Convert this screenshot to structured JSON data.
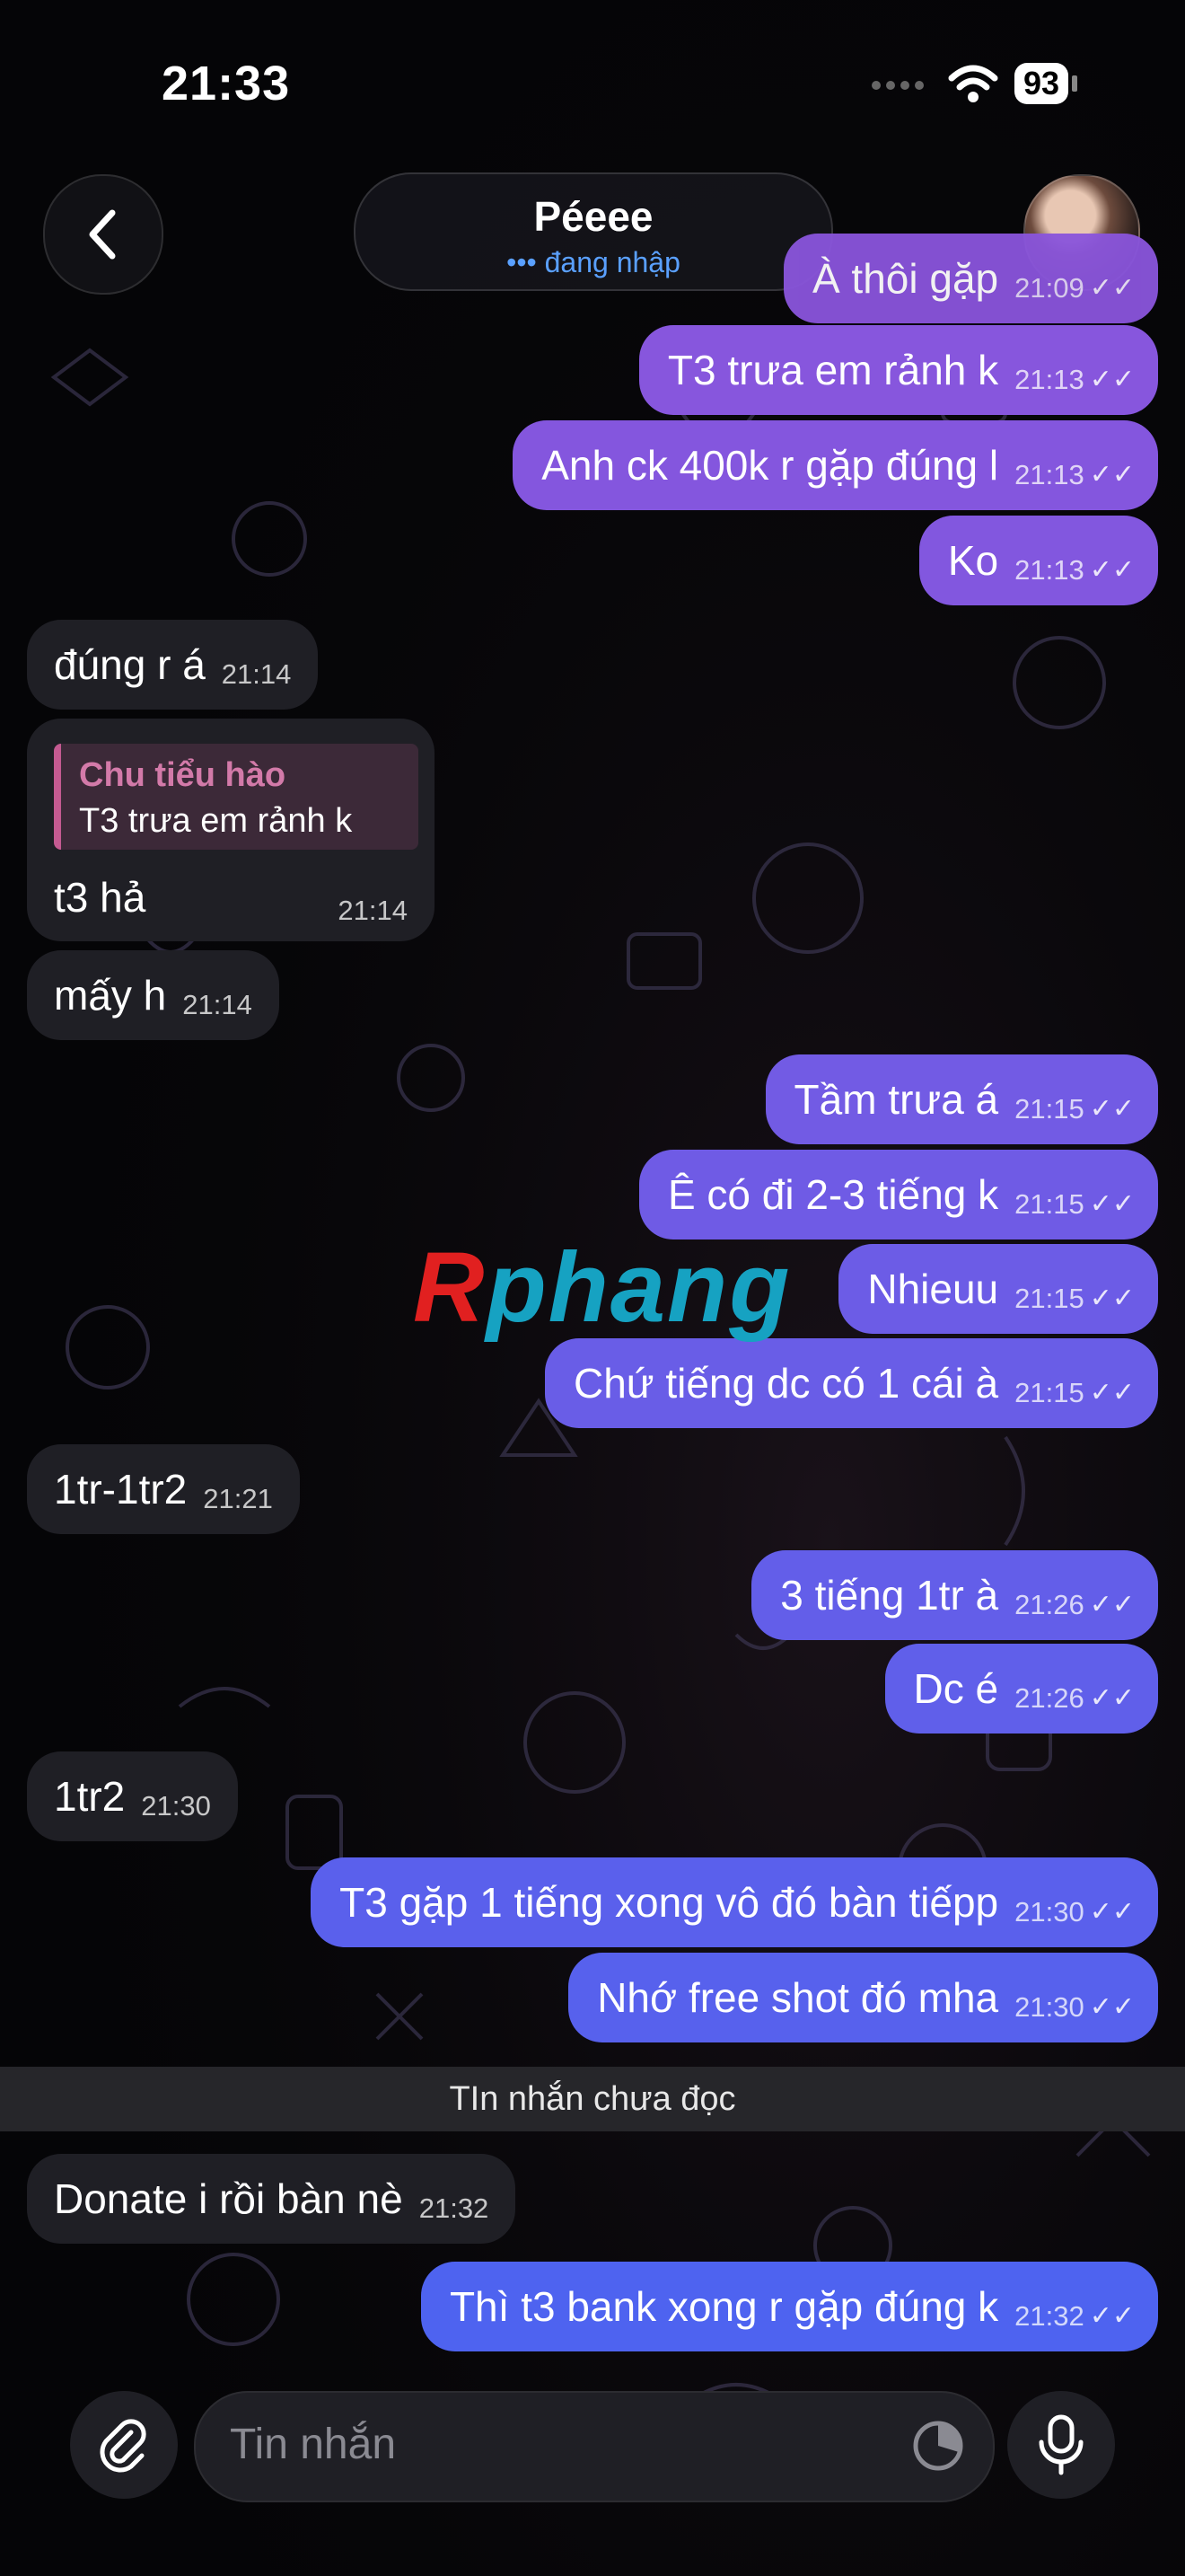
{
  "status_bar": {
    "time": "21:33",
    "battery": "93"
  },
  "header": {
    "contact_name": "Péeee",
    "contact_status": "đang nhập"
  },
  "messages": [
    {
      "dir": "out",
      "text": "À thôi gặp",
      "time": "21:09"
    },
    {
      "dir": "out",
      "text": "T3 trưa em rảnh k",
      "time": "21:13"
    },
    {
      "dir": "out",
      "text": "Anh ck 400k r gặp đúng l",
      "time": "21:13"
    },
    {
      "dir": "out",
      "text": "Ko",
      "time": "21:13"
    },
    {
      "dir": "in",
      "text": "đúng r á",
      "time": "21:14"
    },
    {
      "dir": "in",
      "text": "t3 hả",
      "time": "21:14",
      "reply_to_name": "Chu tiểu hào",
      "reply_to_text": "T3 trưa em rảnh k"
    },
    {
      "dir": "in",
      "text": "mấy h",
      "time": "21:14"
    },
    {
      "dir": "out",
      "text": "Tầm trưa á",
      "time": "21:15"
    },
    {
      "dir": "out",
      "text": "Ê có đi 2-3 tiếng k",
      "time": "21:15"
    },
    {
      "dir": "out",
      "text": "Nhieuu",
      "time": "21:15"
    },
    {
      "dir": "out",
      "text": "Chứ tiếng dc có 1 cái à",
      "time": "21:15"
    },
    {
      "dir": "in",
      "text": "1tr-1tr2",
      "time": "21:21"
    },
    {
      "dir": "out",
      "text": "3 tiếng 1tr à",
      "time": "21:26"
    },
    {
      "dir": "out",
      "text": "Dc é",
      "time": "21:26"
    },
    {
      "dir": "in",
      "text": "1tr2",
      "time": "21:30"
    },
    {
      "dir": "out",
      "text": "T3 gặp 1 tiếng xong vô đó bàn tiếpp",
      "time": "21:30"
    },
    {
      "dir": "out",
      "text": "Nhớ free shot đó mha",
      "time": "21:30"
    },
    {
      "dir": "in",
      "text": "Donate i rồi bàn nè",
      "time": "21:32"
    },
    {
      "dir": "out",
      "text": "Thì t3 bank xong r gặp đúng k",
      "time": "21:32"
    }
  ],
  "unread_divider": "TIn nhắn chưa đọc",
  "watermark": {
    "part1": "R",
    "part2": "phang"
  },
  "composer": {
    "placeholder": "Tin nhắn"
  },
  "colors": {
    "outgoing_top": "#8a55dc",
    "outgoing_bottom": "#4e63f0",
    "incoming": "#1f1f25",
    "accent_blue": "#5aa0ff"
  }
}
